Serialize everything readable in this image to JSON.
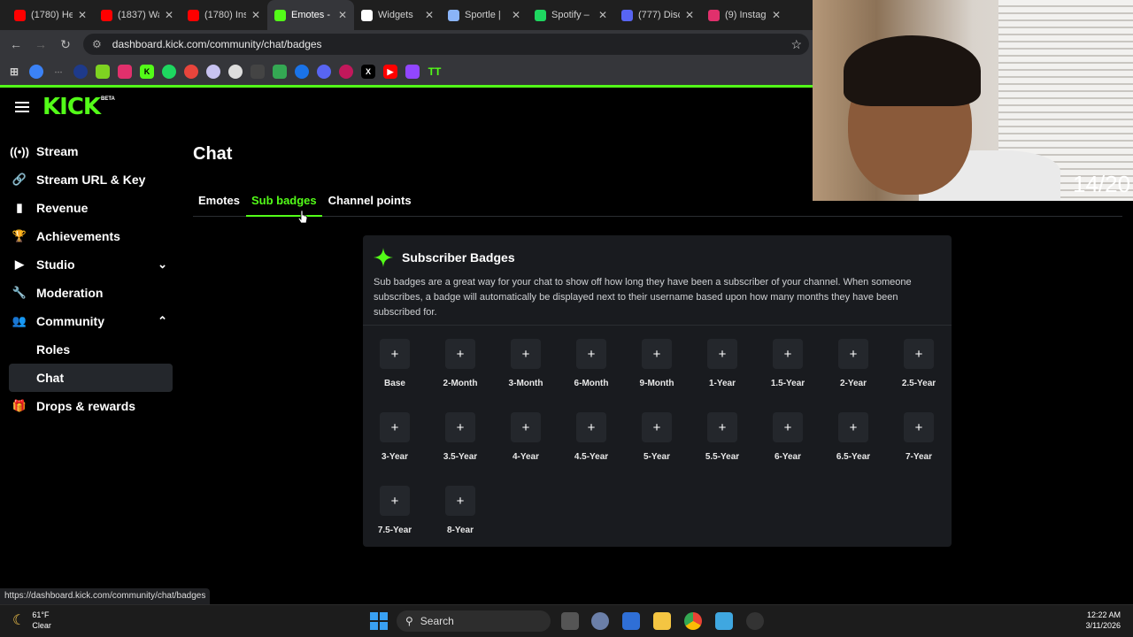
{
  "browser": {
    "tabs": [
      {
        "title": "(1780) He",
        "fav": "youtube-icon",
        "color": "#ff0000"
      },
      {
        "title": "(1837) Wa",
        "fav": "youtube-icon",
        "color": "#ff0000"
      },
      {
        "title": "(1780) Ins",
        "fav": "youtube-icon",
        "color": "#ff0000"
      },
      {
        "title": "Emotes -",
        "fav": "kick-icon",
        "color": "#53fc18",
        "active": true
      },
      {
        "title": "Widgets",
        "fav": "widget-icon",
        "color": "#ffffff"
      },
      {
        "title": "Sportle |",
        "fav": "globe-icon",
        "color": "#8ab4f8"
      },
      {
        "title": "Spotify –",
        "fav": "spotify-icon",
        "color": "#1ed760"
      },
      {
        "title": "(777) Disc",
        "fav": "discord-icon",
        "color": "#5865f2"
      },
      {
        "title": "(9) Instag",
        "fav": "instagram-icon",
        "color": "#e1306c"
      }
    ],
    "url": "dashboard.kick.com/community/chat/badges",
    "status_url": "https://dashboard.kick.com/community/chat/badges"
  },
  "sidebar": {
    "items": [
      {
        "label": "Stream",
        "icon": "broadcast-icon",
        "glyph": "((•))"
      },
      {
        "label": "Stream URL & Key",
        "icon": "link-icon",
        "glyph": "🔗"
      },
      {
        "label": "Revenue",
        "icon": "chart-icon",
        "glyph": "▮"
      },
      {
        "label": "Achievements",
        "icon": "trophy-icon",
        "glyph": "🏆"
      },
      {
        "label": "Studio",
        "icon": "video-icon",
        "glyph": "▶",
        "chevron": "down"
      },
      {
        "label": "Moderation",
        "icon": "wrench-icon",
        "glyph": "🔧"
      },
      {
        "label": "Community",
        "icon": "people-icon",
        "glyph": "👥",
        "chevron": "up"
      },
      {
        "label": "Roles",
        "sub": true
      },
      {
        "label": "Chat",
        "sub": true,
        "selected": true
      },
      {
        "label": "Drops & rewards",
        "icon": "gift-icon",
        "glyph": "🎁"
      }
    ]
  },
  "page": {
    "title": "Chat",
    "tabs": [
      "Emotes",
      "Sub badges",
      "Channel points"
    ],
    "active_tab": "Sub badges"
  },
  "card": {
    "title": "Subscriber Badges",
    "description": "Sub badges are a great way for your chat to show off how long they have been a subscriber of your channel. When someone subscribes, a badge will automatically be displayed next to their username based upon how many months they have been subscribed for.",
    "add_glyph": "+",
    "badges": [
      "Base",
      "2-Month",
      "3-Month",
      "6-Month",
      "9-Month",
      "1-Year",
      "1.5-Year",
      "2-Year",
      "2.5-Year",
      "3-Year",
      "3.5-Year",
      "4-Year",
      "4.5-Year",
      "5-Year",
      "5.5-Year",
      "6-Year",
      "6.5-Year",
      "7-Year",
      "7.5-Year",
      "8-Year"
    ]
  },
  "overlay": {
    "counter": "14/20"
  },
  "taskbar": {
    "temp": "61°F",
    "weather": "Clear",
    "search_placeholder": "Search",
    "time": "12:22 AM",
    "date": "3/11/2026"
  },
  "colors": {
    "brand": "#53fc18",
    "card_bg": "#191b1f",
    "button_bg": "#24272c"
  }
}
